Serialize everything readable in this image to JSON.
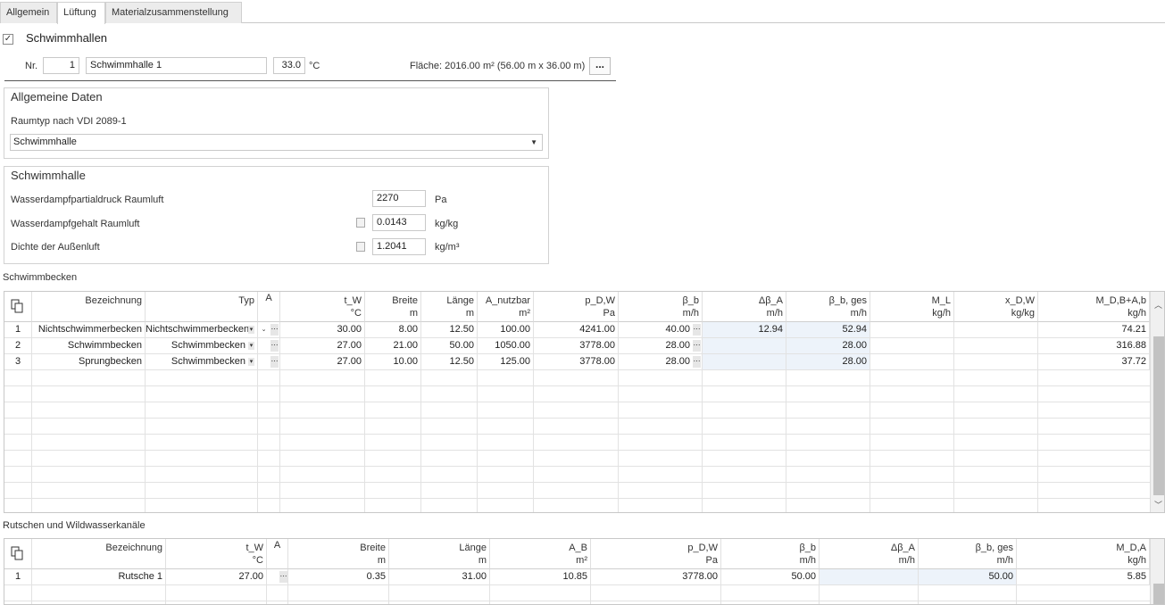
{
  "tabs": [
    {
      "label": "Allgemein",
      "active": false
    },
    {
      "label": "Lüftung",
      "active": true
    },
    {
      "label": "Materialzusammenstellung",
      "active": false
    }
  ],
  "hall": {
    "checked": true,
    "title": "Schwimmhallen",
    "nr_label": "Nr.",
    "nr": "1",
    "name": "Schwimmhalle 1",
    "temp": "33.0",
    "temp_unit": "°C",
    "area_label": "Fläche: 2016.00  m² (56.00 m x 36.00 m)",
    "more_label": "..."
  },
  "general": {
    "title": "Allgemeine Daten",
    "room_type_label": "Raumtyp nach VDI 2089-1",
    "room_type_value": "Schwimmhalle"
  },
  "hall_data": {
    "title": "Schwimmhalle",
    "rows": [
      {
        "label": "Wasserdampfpartialdruck Raumluft",
        "value": "2270",
        "unit": "Pa"
      },
      {
        "label": "Wasserdampfgehalt Raumluft",
        "value": "0.0143",
        "unit": "kg/kg"
      },
      {
        "label": "Dichte der Außenluft",
        "value": "1.2041",
        "unit": "kg/m³"
      }
    ]
  },
  "pools": {
    "section_label": "Schwimmbecken",
    "headers": [
      {
        "name": "",
        "unit": ""
      },
      {
        "name": "Bezeichnung",
        "unit": ""
      },
      {
        "name": "Typ",
        "unit": ""
      },
      {
        "name": "A",
        "unit": ""
      },
      {
        "name": "t_W",
        "unit": "°C"
      },
      {
        "name": "Breite",
        "unit": "m"
      },
      {
        "name": "Länge",
        "unit": "m"
      },
      {
        "name": "A_nutzbar",
        "unit": "m²"
      },
      {
        "name": "p_D,W",
        "unit": "Pa"
      },
      {
        "name": "β_b",
        "unit": "m/h"
      },
      {
        "name": "Δβ_A",
        "unit": "m/h"
      },
      {
        "name": "β_b, ges",
        "unit": "m/h"
      },
      {
        "name": "M_L",
        "unit": "kg/h"
      },
      {
        "name": "x_D,W",
        "unit": "kg/kg"
      },
      {
        "name": "M_D,B+A,b",
        "unit": "kg/h"
      }
    ],
    "rows": [
      {
        "nr": "1",
        "name": "Nichtschwimmerbecken",
        "type": "Nichtschwimmerbecken",
        "tw": "30.00",
        "breite": "8.00",
        "laenge": "12.50",
        "anutz": "100.00",
        "pdw": "4241.00",
        "bb": "40.00",
        "dba": "12.94",
        "bbges": "52.94",
        "ml": "",
        "xdw": "",
        "md": "74.21"
      },
      {
        "nr": "2",
        "name": "Schwimmbecken",
        "type": "Schwimmbecken",
        "tw": "27.00",
        "breite": "21.00",
        "laenge": "50.00",
        "anutz": "1050.00",
        "pdw": "3778.00",
        "bb": "28.00",
        "dba": "",
        "bbges": "28.00",
        "ml": "",
        "xdw": "",
        "md": "316.88"
      },
      {
        "nr": "3",
        "name": "Sprungbecken",
        "type": "Schwimmbecken",
        "tw": "27.00",
        "breite": "10.00",
        "laenge": "12.50",
        "anutz": "125.00",
        "pdw": "3778.00",
        "bb": "28.00",
        "dba": "",
        "bbges": "28.00",
        "ml": "",
        "xdw": "",
        "md": "37.72"
      }
    ]
  },
  "slides": {
    "section_label": "Rutschen und Wildwasserkanäle",
    "headers": [
      {
        "name": "",
        "unit": ""
      },
      {
        "name": "Bezeichnung",
        "unit": ""
      },
      {
        "name": "t_W",
        "unit": "°C"
      },
      {
        "name": "A",
        "unit": ""
      },
      {
        "name": "Breite",
        "unit": "m"
      },
      {
        "name": "Länge",
        "unit": "m"
      },
      {
        "name": "A_B",
        "unit": "m²"
      },
      {
        "name": "p_D,W",
        "unit": "Pa"
      },
      {
        "name": "β_b",
        "unit": "m/h"
      },
      {
        "name": "Δβ_A",
        "unit": "m/h"
      },
      {
        "name": "β_b, ges",
        "unit": "m/h"
      },
      {
        "name": "M_D,A",
        "unit": "kg/h"
      }
    ],
    "rows": [
      {
        "nr": "1",
        "name": "Rutsche 1",
        "tw": "27.00",
        "breite": "0.35",
        "laenge": "31.00",
        "ab": "10.85",
        "pdw": "3778.00",
        "bb": "50.00",
        "dba": "",
        "bbges": "50.00",
        "md": "5.85"
      }
    ]
  },
  "icons": {
    "check": "check-icon",
    "copy": "copy-icon",
    "dropdown": "chevron-down-icon",
    "calc": "calculator-icon",
    "more": "ellipsis-icon"
  }
}
